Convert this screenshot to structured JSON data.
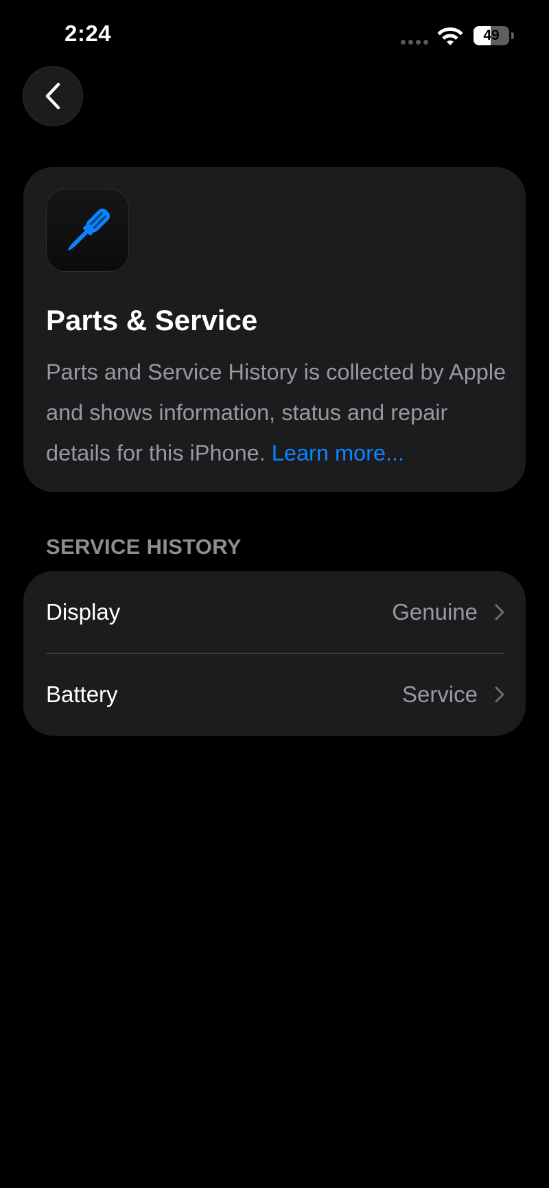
{
  "status_bar": {
    "time": "2:24",
    "battery_level": "49",
    "battery_fraction": 0.49,
    "icons": [
      "signal-dots-icon",
      "wifi-icon",
      "battery-icon"
    ]
  },
  "navigation": {
    "back_icon": "chevron-left-icon"
  },
  "info_card": {
    "icon": "screwdriver-icon",
    "title": "Parts & Service",
    "description": "Parts and Service History is collected by Apple and shows information, status and repair details for this iPhone.",
    "learn_more": "Learn more..."
  },
  "service_history": {
    "header": "SERVICE HISTORY",
    "rows": [
      {
        "label": "Display",
        "value": "Genuine"
      },
      {
        "label": "Battery",
        "value": "Service"
      }
    ],
    "chevron_icon": "chevron-right-icon"
  },
  "colors": {
    "background": "#000000",
    "card": "#1c1c1e",
    "accent": "#0a84ff",
    "secondary_text": "#98989f",
    "divider": "#38383a"
  }
}
